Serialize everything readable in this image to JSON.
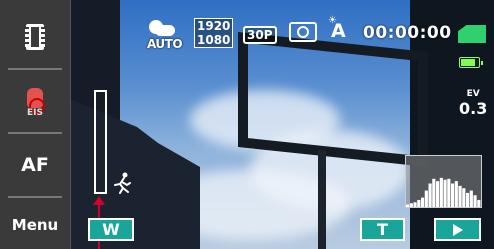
{
  "status_bar": {
    "scene_mode": "AUTO",
    "resolution_top": "1920",
    "resolution_bottom": "1080",
    "frame_rate": "30P",
    "white_balance": "A",
    "record_time": "00:00:00",
    "ev_label": "EV",
    "ev_value": "0.3",
    "battery_level": 0.85
  },
  "left_panel": {
    "eis_label": "EIS",
    "af_label": "AF",
    "menu_label": "Menu"
  },
  "zoom": {
    "wide_label": "W",
    "tele_label": "T",
    "level": 0.0
  },
  "histogram": {
    "bins": [
      0.05,
      0.08,
      0.1,
      0.15,
      0.2,
      0.35,
      0.5,
      0.6,
      0.55,
      0.62,
      0.58,
      0.6,
      0.5,
      0.55,
      0.45,
      0.4,
      0.3,
      0.35,
      0.25,
      0.15
    ]
  },
  "colors": {
    "panel": "#3a3a3a",
    "teal_button": "#1aa59a",
    "sd_green": "#2fd16e",
    "zoom_arrow": "#d0002a"
  },
  "icons": [
    "film-strip-icon",
    "eis-hand-icon",
    "scene-auto-icon",
    "spot-meter-icon",
    "white-balance-auto-icon",
    "sd-card-icon",
    "battery-icon",
    "running-figure-icon",
    "play-icon"
  ]
}
